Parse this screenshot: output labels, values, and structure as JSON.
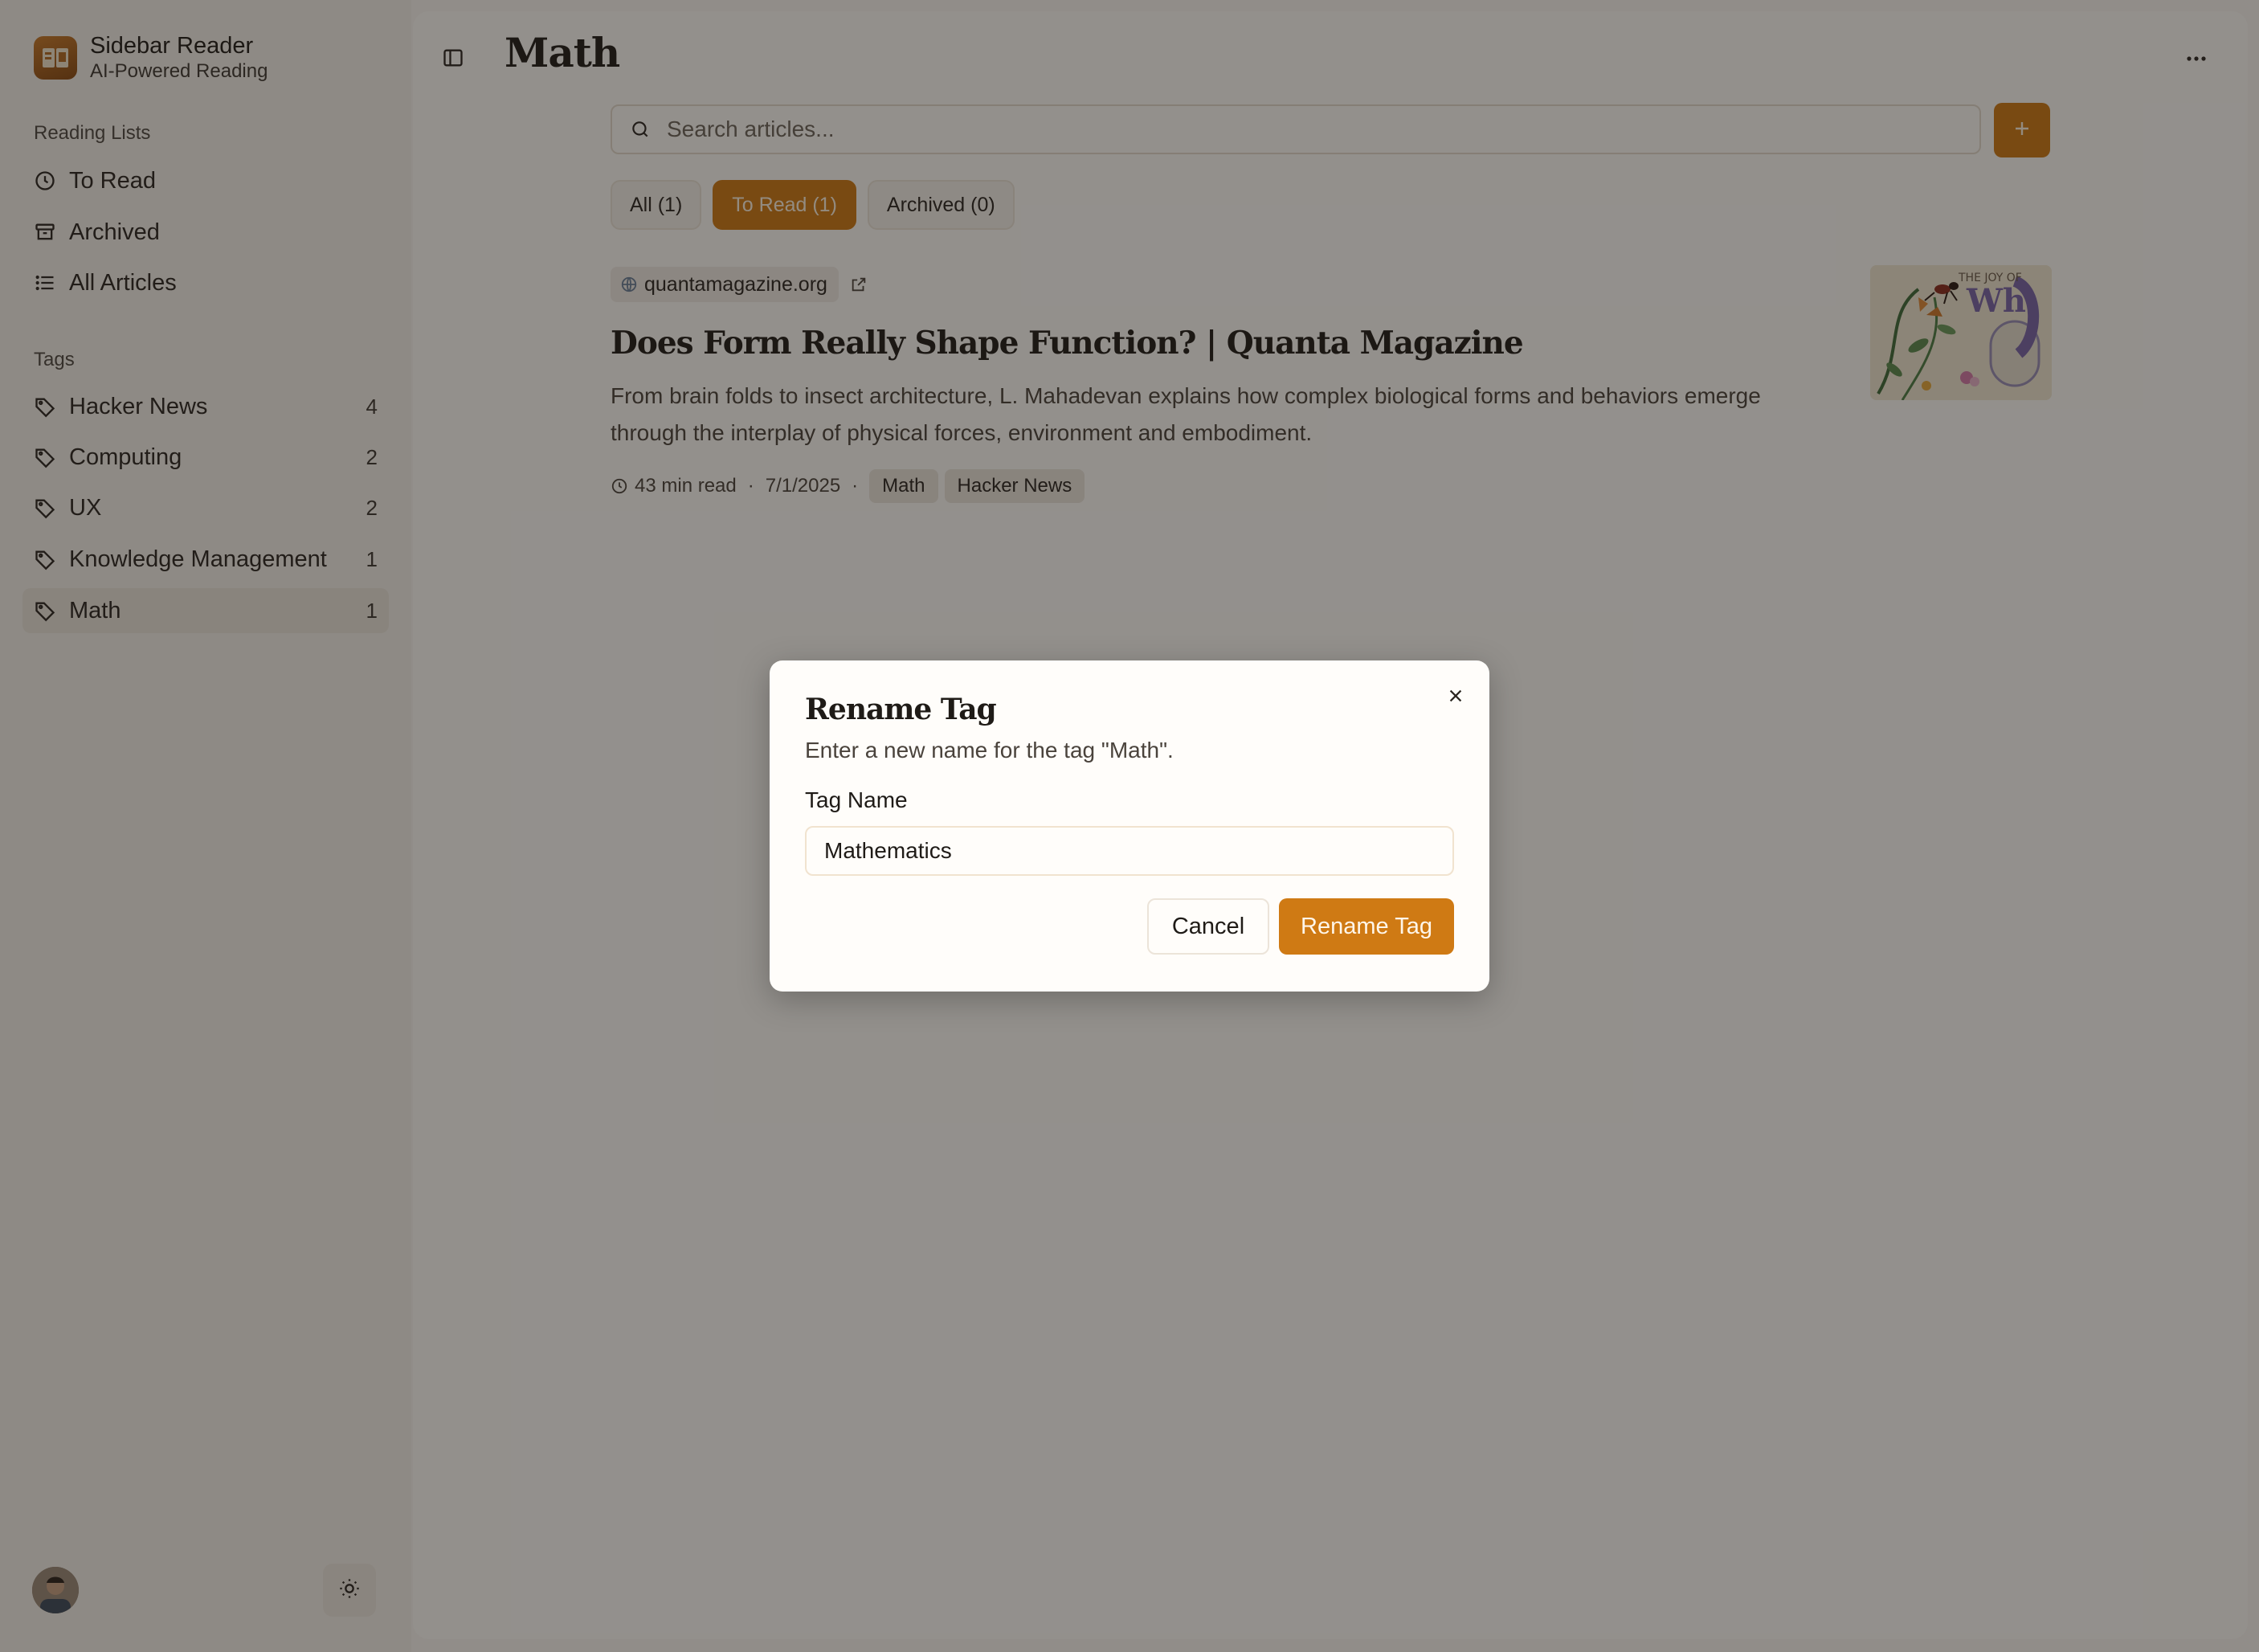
{
  "brand": {
    "title": "Sidebar Reader",
    "subtitle": "AI-Powered Reading"
  },
  "sidebar": {
    "reading_lists_label": "Reading Lists",
    "lists": [
      {
        "label": "To Read",
        "icon": "clock-icon"
      },
      {
        "label": "Archived",
        "icon": "archive-icon"
      },
      {
        "label": "All Articles",
        "icon": "list-icon"
      }
    ],
    "tags_label": "Tags",
    "tags": [
      {
        "label": "Hacker News",
        "count": "4"
      },
      {
        "label": "Computing",
        "count": "2"
      },
      {
        "label": "UX",
        "count": "2"
      },
      {
        "label": "Knowledge Management",
        "count": "1"
      },
      {
        "label": "Math",
        "count": "1",
        "active": true
      }
    ]
  },
  "header": {
    "title": "Math"
  },
  "search": {
    "placeholder": "Search articles..."
  },
  "tabs": [
    {
      "label": "All (1)"
    },
    {
      "label": "To Read (1)",
      "active": true
    },
    {
      "label": "Archived (0)"
    }
  ],
  "article": {
    "source": "quantamagazine.org",
    "title": "Does Form Really Shape Function? | Quanta Magazine",
    "description": "From brain folds to insect architecture, L. Mahadevan explains how complex biological forms and behaviors emerge through the interplay of physical forces, environment and embodiment.",
    "read_time": "43 min read",
    "date": "7/1/2025",
    "tags": [
      "Math",
      "Hacker News"
    ],
    "thumbnail_text": [
      "THE JOY OF",
      "Wh"
    ]
  },
  "dialog": {
    "title": "Rename Tag",
    "description": "Enter a new name for the tag \"Math\".",
    "field_label": "Tag Name",
    "field_value": "Mathematics",
    "cancel_label": "Cancel",
    "confirm_label": "Rename Tag"
  },
  "colors": {
    "accent": "#cf7a14",
    "sidebar_bg": "#f6f2ec",
    "overlay": "rgba(25,22,18,0.47)"
  }
}
